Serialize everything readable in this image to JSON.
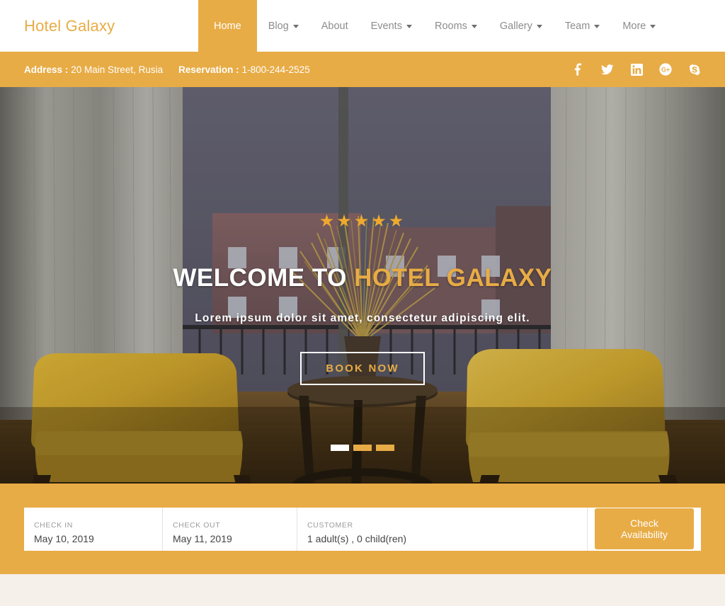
{
  "brand": {
    "name": "Hotel Galaxy"
  },
  "nav": {
    "items": [
      {
        "label": "Home",
        "active": true,
        "caret": false,
        "icon": ""
      },
      {
        "label": "Blog",
        "active": false,
        "caret": true,
        "icon": "chevron-down-icon"
      },
      {
        "label": "About",
        "active": false,
        "caret": false,
        "icon": ""
      },
      {
        "label": "Events",
        "active": false,
        "caret": true,
        "icon": "chevron-down-icon"
      },
      {
        "label": "Rooms",
        "active": false,
        "caret": true,
        "icon": "chevron-down-icon"
      },
      {
        "label": "Gallery",
        "active": false,
        "caret": true,
        "icon": "chevron-down-icon"
      },
      {
        "label": "Team",
        "active": false,
        "caret": true,
        "icon": "chevron-down-icon"
      },
      {
        "label": "More",
        "active": false,
        "caret": true,
        "icon": "chevron-down-icon"
      }
    ]
  },
  "infobar": {
    "address_label": "Address :",
    "address_value": "20 Main Street, Rusia",
    "reservation_label": "Reservation :",
    "reservation_value": "1-800-244-2525",
    "socials": [
      {
        "name": "facebook-icon",
        "title": "Facebook"
      },
      {
        "name": "twitter-icon",
        "title": "Twitter"
      },
      {
        "name": "linkedin-icon",
        "title": "LinkedIn"
      },
      {
        "name": "googleplus-icon",
        "title": "Google Plus"
      },
      {
        "name": "skype-icon",
        "title": "Skype"
      }
    ]
  },
  "hero": {
    "stars": "★★★★★",
    "star_count": 5,
    "title_plain": "WELCOME TO ",
    "title_accent": "HOTEL GALAXY",
    "subtitle": "Lorem ipsum dolor sit amet, consectetur adipiscing elit.",
    "cta_label": "BOOK NOW",
    "slides": [
      {
        "active": true
      },
      {
        "active": false
      },
      {
        "active": false
      }
    ]
  },
  "booking": {
    "fields": [
      {
        "label": "CHECK IN",
        "value": "May 10, 2019"
      },
      {
        "label": "CHECK OUT",
        "value": "May 11, 2019"
      },
      {
        "label": "CUSTOMER",
        "value": "1 adult(s) , 0 child(ren)"
      }
    ],
    "submit_label": "Check Availability"
  },
  "colors": {
    "brand_orange": "#e8ac46",
    "star_orange": "#f0a92e",
    "page_bg": "#f5f0ea",
    "nav_text": "#8d8d8d",
    "card_white": "#ffffff"
  }
}
